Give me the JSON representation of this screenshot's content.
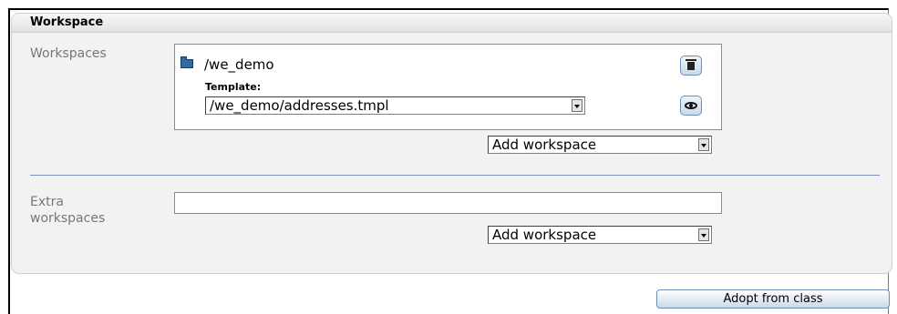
{
  "section": {
    "title": "Workspace"
  },
  "workspaces": {
    "label": "Workspaces",
    "entry": {
      "path": "/we_demo",
      "template_label": "Template:",
      "template_value": "/we_demo/addresses.tmpl"
    },
    "add_select": "Add workspace"
  },
  "extra": {
    "label_line1": "Extra",
    "label_line2": "workspaces",
    "input_value": "",
    "add_select": "Add workspace"
  },
  "actions": {
    "adopt_label": "Adopt from class"
  },
  "colors": {
    "divider": "#7b97bd",
    "button_border": "#6d8fb5",
    "folder": "#2f6aa0"
  }
}
